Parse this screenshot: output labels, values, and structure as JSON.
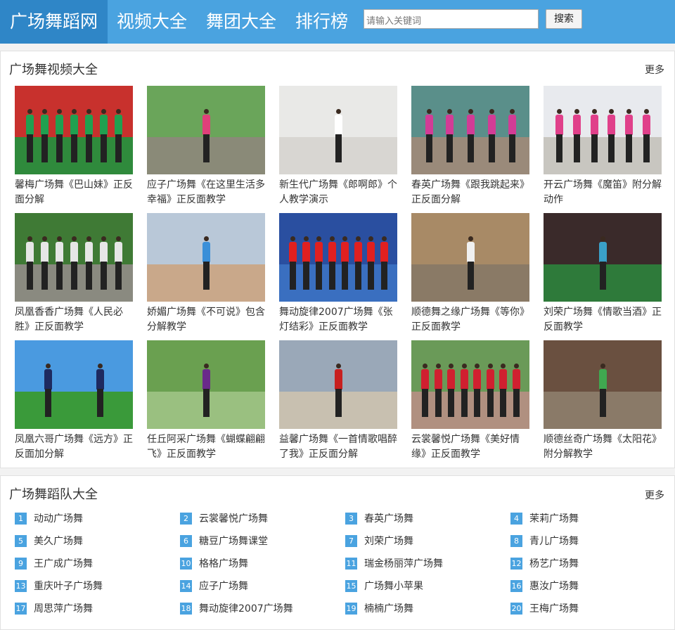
{
  "header": {
    "brand": "广场舞蹈网",
    "nav": [
      "视频大全",
      "舞团大全",
      "排行榜"
    ],
    "search_placeholder": "请输入关键词",
    "search_button": "搜索"
  },
  "videos_section": {
    "title": "广场舞视频大全",
    "more": "更多",
    "items": [
      {
        "caption": "馨梅广场舞《巴山妹》正反面分解",
        "bg": "#c8312d",
        "ground": "#2f8a3c",
        "fig": "#20a050",
        "count": 7
      },
      {
        "caption": "应子广场舞《在这里生活多幸福》正反面教学",
        "bg": "#6aa55a",
        "ground": "#8a8a78",
        "fig": "#e0407a",
        "count": 1
      },
      {
        "caption": "新生代广场舞《郎啊郎》个人教学演示",
        "bg": "#e9e9e7",
        "ground": "#d8d6d2",
        "fig": "#ffffff",
        "count": 1
      },
      {
        "caption": "春英广场舞《跟我跳起来》正反面分解",
        "bg": "#5a8f8a",
        "ground": "#9a8a7a",
        "fig": "#d23c96",
        "count": 5
      },
      {
        "caption": "开云广场舞《魔笛》附分解动作",
        "bg": "#e8eaee",
        "ground": "#c8c6c0",
        "fig": "#e0408a",
        "count": 6
      },
      {
        "caption": "凤凰香香广场舞《人民必胜》正反面教学",
        "bg": "#3f7a35",
        "ground": "#8a8a80",
        "fig": "#e6e6e6",
        "count": 7
      },
      {
        "caption": "娇媚广场舞《不可说》包含分解教学",
        "bg": "#b9c8d8",
        "ground": "#c9a88a",
        "fig": "#3a8fd8",
        "count": 1
      },
      {
        "caption": "舞动旋律2007广场舞《张灯结彩》正反面教学",
        "bg": "#2a4fa0",
        "ground": "#3a6fc0",
        "fig": "#e02020",
        "count": 8
      },
      {
        "caption": "顺德舞之缘广场舞《等你》正反面教学",
        "bg": "#a88a66",
        "ground": "#8a7a66",
        "fig": "#f0f0f0",
        "count": 1
      },
      {
        "caption": "刘荣广场舞《情歌当酒》正反面教学",
        "bg": "#3a2a2a",
        "ground": "#2e7a3a",
        "fig": "#3aa0c8",
        "count": 1
      },
      {
        "caption": "凤凰六哥广场舞《远方》正反面加分解",
        "bg": "#4a9ae0",
        "ground": "#3a9a3a",
        "fig": "#1e2a60",
        "count": 2
      },
      {
        "caption": "任丘阿采广场舞《蝴蝶翩翩飞》正反面教学",
        "bg": "#6aa050",
        "ground": "#9ac080",
        "fig": "#6a2a8a",
        "count": 1
      },
      {
        "caption": "益馨广场舞《一首情歌唱醉了我》正反面分解",
        "bg": "#9aa8b8",
        "ground": "#c8c0b0",
        "fig": "#c82020",
        "count": 1
      },
      {
        "caption": "云裳馨悦广场舞《美好情缘》正反面教学",
        "bg": "#6a9a58",
        "ground": "#b09080",
        "fig": "#d02030",
        "count": 8
      },
      {
        "caption": "顺德丝奇广场舞《太阳花》附分解教学",
        "bg": "#6a5040",
        "ground": "#8a7a68",
        "fig": "#40a850",
        "count": 1
      }
    ]
  },
  "teams_section": {
    "title": "广场舞蹈队大全",
    "more": "更多",
    "items": [
      {
        "num": "1",
        "name": "动动广场舞"
      },
      {
        "num": "2",
        "name": "云裳馨悦广场舞"
      },
      {
        "num": "3",
        "name": "春英广场舞"
      },
      {
        "num": "4",
        "name": "茉莉广场舞"
      },
      {
        "num": "5",
        "name": "美久广场舞"
      },
      {
        "num": "6",
        "name": "糖豆广场舞课堂"
      },
      {
        "num": "7",
        "name": "刘荣广场舞"
      },
      {
        "num": "8",
        "name": "青儿广场舞"
      },
      {
        "num": "9",
        "name": "王广成广场舞"
      },
      {
        "num": "10",
        "name": "格格广场舞"
      },
      {
        "num": "11",
        "name": "瑞金杨丽萍广场舞"
      },
      {
        "num": "12",
        "name": "杨艺广场舞"
      },
      {
        "num": "13",
        "name": "重庆叶子广场舞"
      },
      {
        "num": "14",
        "name": "应子广场舞"
      },
      {
        "num": "15",
        "name": "广场舞小苹果"
      },
      {
        "num": "16",
        "name": "惠汝广场舞"
      },
      {
        "num": "17",
        "name": "周思萍广场舞"
      },
      {
        "num": "18",
        "name": "舞动旋律2007广场舞"
      },
      {
        "num": "19",
        "name": "楠楠广场舞"
      },
      {
        "num": "20",
        "name": "王梅广场舞"
      }
    ]
  }
}
